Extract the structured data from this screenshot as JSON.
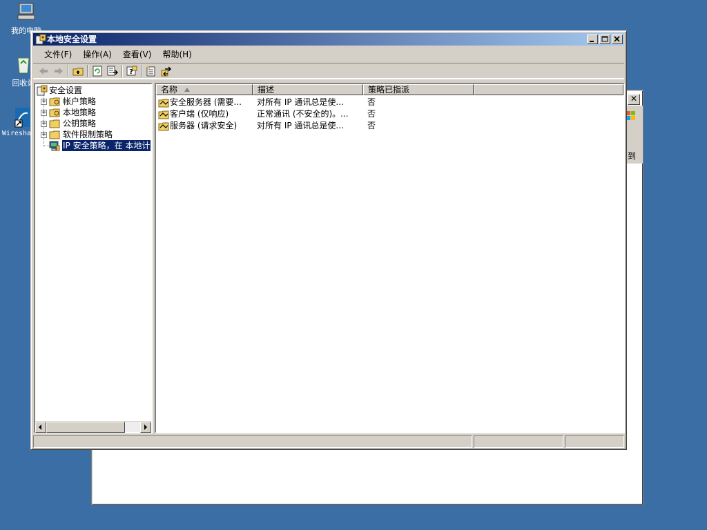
{
  "desktop": {
    "icons": [
      {
        "label": "我的电脑",
        "icon": "my-computer-icon"
      },
      {
        "label": "回收站",
        "icon": "recycle-bin-icon"
      },
      {
        "label": "Wireshark",
        "icon": "wireshark-shortcut-icon"
      }
    ]
  },
  "background_window": {
    "close_label": "✕",
    "strip_text": "到"
  },
  "window": {
    "title": "本地安全设置",
    "buttons": {
      "minimize": "_",
      "maximize": "□",
      "close": "✕"
    },
    "menu": [
      "文件(F)",
      "操作(A)",
      "查看(V)",
      "帮助(H)"
    ],
    "toolbar": [
      "back-icon",
      "forward-icon",
      "up-folder-icon",
      "refresh-icon",
      "export-list-icon",
      "help-icon",
      "properties-icon",
      "import-export-icon"
    ],
    "tree": {
      "root": "安全设置",
      "children": [
        {
          "label": "帐户策略",
          "expandable": true
        },
        {
          "label": "本地策略",
          "expandable": true
        },
        {
          "label": "公钥策略",
          "expandable": true
        },
        {
          "label": "软件限制策略",
          "expandable": true
        },
        {
          "label": "IP 安全策略，在 本地计",
          "expandable": false,
          "selected": true
        }
      ]
    },
    "list": {
      "columns": [
        "名称",
        "描述",
        "策略已指派"
      ],
      "sort_column": "名称",
      "rows": [
        {
          "name": "安全服务器 (需要...",
          "description": "对所有 IP 通讯总是使...",
          "assigned": "否"
        },
        {
          "name": "客户端 (仅响应)",
          "description": "正常通讯 (不安全的)。...",
          "assigned": "否"
        },
        {
          "name": "服务器 (请求安全)",
          "description": "对所有 IP 通讯总是使...",
          "assigned": "否"
        }
      ]
    },
    "status": [
      "",
      "",
      ""
    ]
  }
}
